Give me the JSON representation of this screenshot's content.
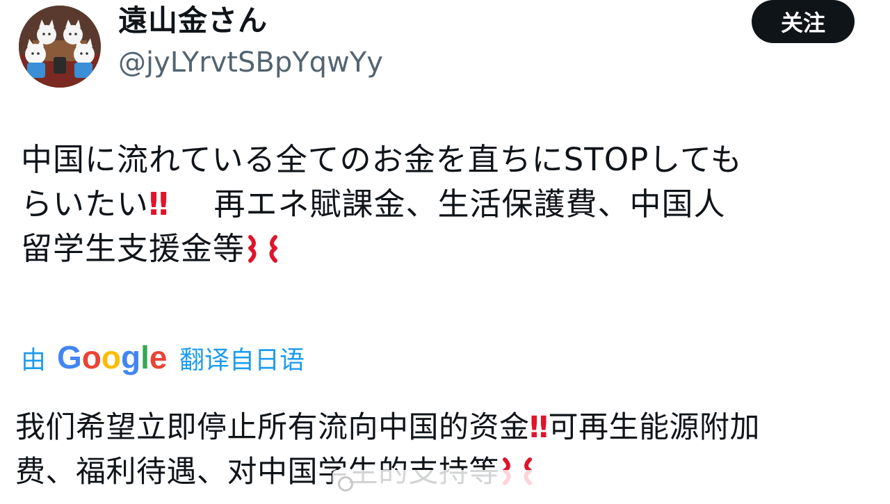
{
  "user": {
    "display_name": "遠山金さん",
    "handle": "@jyLYrvtSBpYqwYy"
  },
  "follow_button": {
    "label": "关注"
  },
  "tweet": {
    "line1": "中国に流れている全てのお金を直ちにSTOPしても",
    "line2_a": "らいたい",
    "bangs": "‼",
    "line2_b": "再エネ賦課金、生活保護費、中国人",
    "line3": "留学生支援金等"
  },
  "translation": {
    "prefix": "由",
    "provider": "Google",
    "suffix": "翻译自日语"
  },
  "translated": {
    "part1": "我们希望立即停止所有流向中国的资金",
    "bangs": "‼",
    "part2": "可再生能源附加",
    "part3": "费、福利待遇、对中国学生的支持等"
  },
  "icons": {
    "avatar": "cats-avatar",
    "anger": "anger-symbol-icon",
    "double_exclamation": "double-exclamation-icon"
  },
  "colors": {
    "text": "#0f1419",
    "secondary": "#536471",
    "link": "#1d9bf0",
    "button_bg": "#0f1419",
    "emoji_red": "#e0142b",
    "google_blue": "#4285F4",
    "google_red": "#EA4335",
    "google_yellow": "#FBBC05",
    "google_green": "#34A853"
  }
}
